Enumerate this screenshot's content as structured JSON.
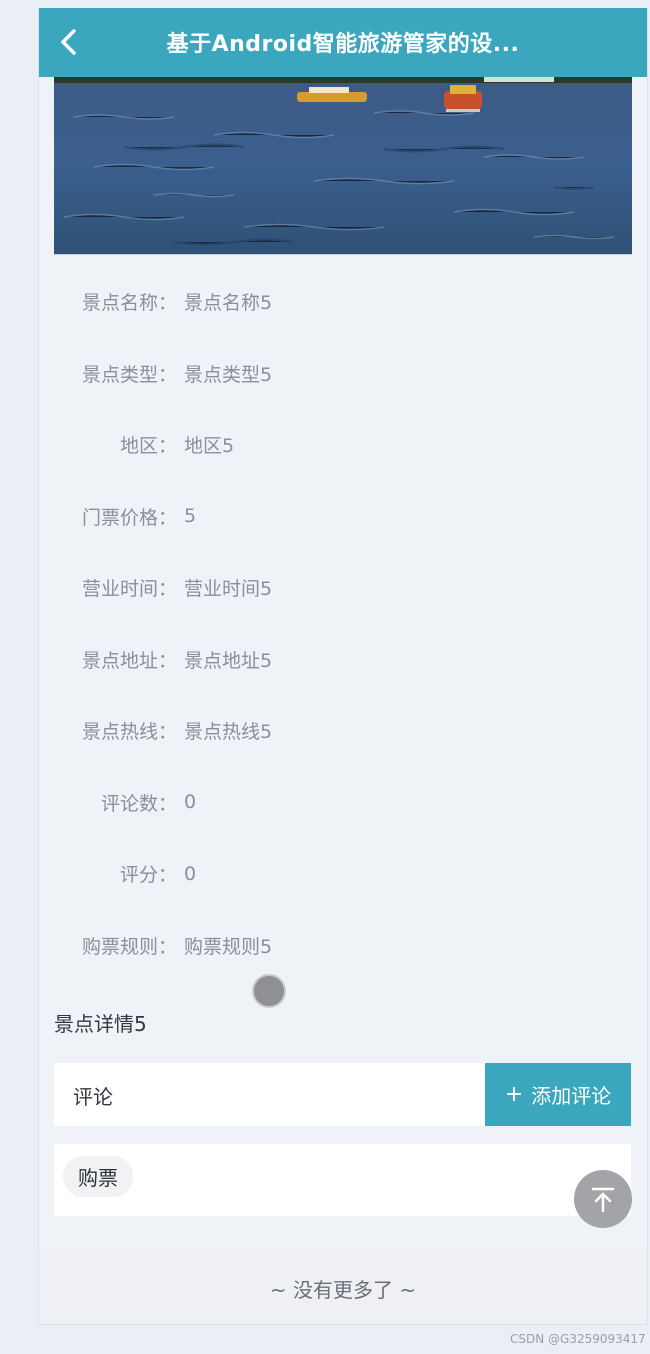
{
  "header": {
    "back_icon": "chevron-left-icon",
    "title": "基于Android智能旅游管家的设..."
  },
  "colors": {
    "accent": "#3aa7bf",
    "page_bg": "#eff2f6"
  },
  "details": [
    {
      "label": "景点名称",
      "value": "景点名称5"
    },
    {
      "label": "景点类型",
      "value": "景点类型5"
    },
    {
      "label": "地区",
      "value": "地区5"
    },
    {
      "label": "门票价格",
      "value": "5"
    },
    {
      "label": "营业时间",
      "value": "营业时间5"
    },
    {
      "label": "景点地址",
      "value": "景点地址5"
    },
    {
      "label": "景点热线",
      "value": "景点热线5"
    },
    {
      "label": "评论数",
      "value": "0"
    },
    {
      "label": "评分",
      "value": "0"
    },
    {
      "label": "购票规则",
      "value": "购票规则5"
    }
  ],
  "colon": "：",
  "description": "景点详情5",
  "comment": {
    "label": "评论",
    "add_button_icon": "plus-icon",
    "add_button_label": "添加评论"
  },
  "ticket": {
    "chip_label": "购票"
  },
  "back_to_top_icon": "arrow-up-to-top-icon",
  "footer": {
    "no_more_text": "~ 没有更多了 ~"
  },
  "watermark": "CSDN @G3259093417"
}
